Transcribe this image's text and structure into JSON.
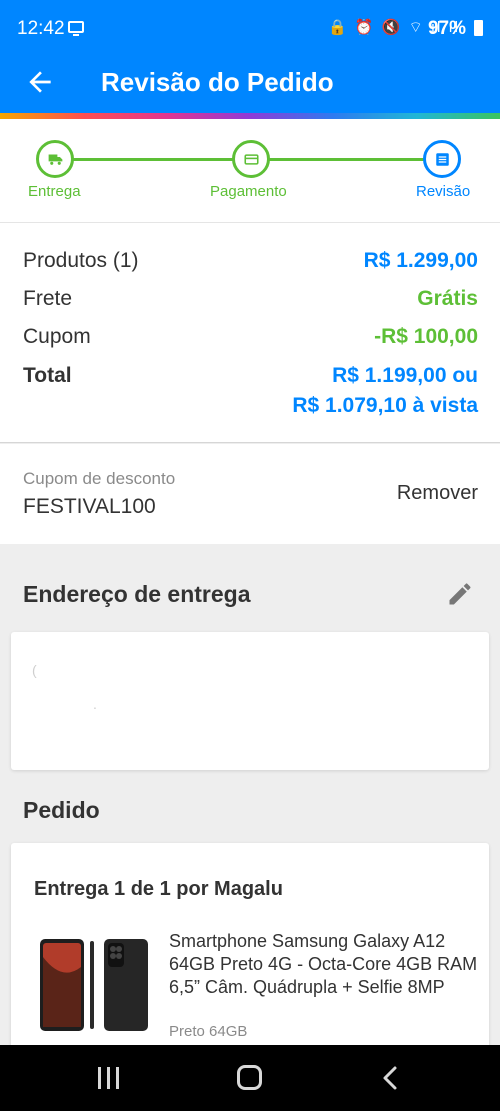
{
  "status_bar": {
    "time": "12:42",
    "icons": "🔒 ⏰ 🔇 ⌔ ıl ıl",
    "battery": "97%"
  },
  "app_bar": {
    "title": "Revisão do Pedido"
  },
  "stepper": {
    "steps": [
      {
        "label": "Entrega",
        "icon": "truck-icon"
      },
      {
        "label": "Pagamento",
        "icon": "card-icon"
      },
      {
        "label": "Revisão",
        "icon": "list-icon"
      }
    ],
    "colors": {
      "done": "#5dbf36",
      "current": "#0086ff"
    }
  },
  "summary": {
    "products_label": "Produtos (1)",
    "products_value": "R$ 1.299,00",
    "shipping_label": "Frete",
    "shipping_value": "Grátis",
    "coupon_label": "Cupom",
    "coupon_value": "-R$ 100,00",
    "total_label": "Total",
    "total_value": "R$ 1.199,00 ou",
    "total_cash": "R$ 1.079,10 à vista"
  },
  "coupon": {
    "caption": "Cupom de desconto",
    "code": "FESTIVAL100",
    "remove_label": "Remover"
  },
  "address": {
    "title": "Endereço de entrega",
    "line1": "(",
    "line2": "."
  },
  "order": {
    "title": "Pedido",
    "delivery_title": "Entrega 1 de 1 por Magalu",
    "product_name": "Smartphone Samsung Galaxy A12 64GB Preto 4G - Octa-Core 4GB RAM 6,5” Câm. Quádrupla + Selfie 8MP",
    "product_variant": "Preto 64GB"
  },
  "theme": {
    "primary": "#0086ff",
    "success": "#5dbf36"
  }
}
